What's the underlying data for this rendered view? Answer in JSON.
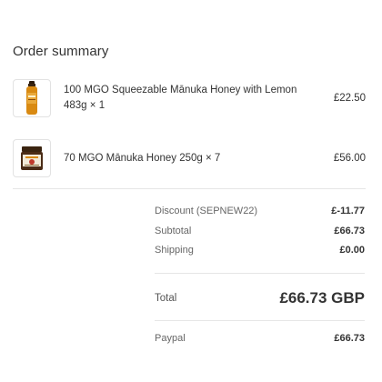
{
  "order": {
    "title": "Order summary",
    "items": [
      {
        "name_line1": "100 MGO Squeezable Mānuka Honey with Lemon",
        "name_line2": "483g × 1",
        "price": "£22.50",
        "icon": "squeeze-bottle-icon"
      },
      {
        "name_line1": "70 MGO Mānuka Honey 250g × 7",
        "price": "£56.00",
        "icon": "honey-jar-icon"
      }
    ],
    "discount_label": "Discount (SEPNEW22)",
    "discount_value": "£-11.77",
    "subtotal_label": "Subtotal",
    "subtotal_value": "£66.73",
    "shipping_label": "Shipping",
    "shipping_value": "£0.00",
    "total_label": "Total",
    "total_value": "£66.73 GBP",
    "payment_label": "Paypal",
    "payment_value": "£66.73"
  },
  "colors": {
    "honey": "#d98a12",
    "jar_lid": "#3a2410",
    "jar_body": "#4a2c16",
    "label": "#f2ead8",
    "accent_red": "#c0392b"
  }
}
